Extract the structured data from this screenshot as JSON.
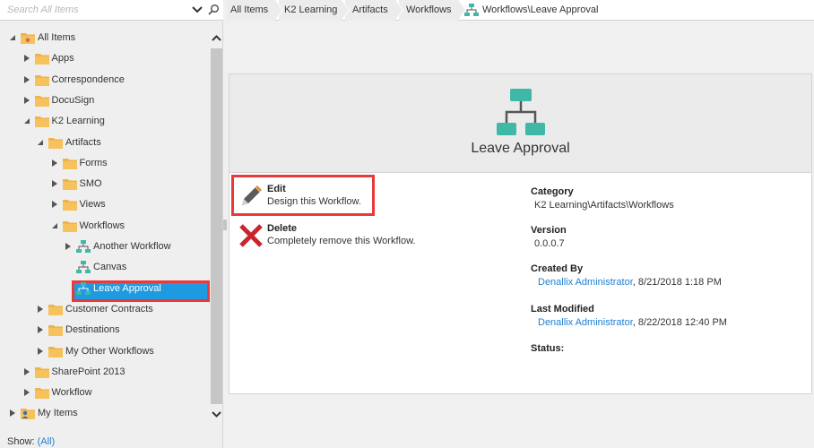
{
  "search": {
    "placeholder": "Search All Items"
  },
  "tree": {
    "all_items": "All Items",
    "apps": "Apps",
    "correspondence": "Correspondence",
    "docusign": "DocuSign",
    "k2_learning": "K2 Learning",
    "artifacts": "Artifacts",
    "forms": "Forms",
    "smo": "SMO",
    "views": "Views",
    "workflows": "Workflows",
    "another_workflow": "Another Workflow",
    "canvas": "Canvas",
    "leave_approval": "Leave Approval",
    "customer_contracts": "Customer Contracts",
    "destinations": "Destinations",
    "my_other_workflows": "My Other Workflows",
    "sharepoint_2013": "SharePoint 2013",
    "workflow": "Workflow",
    "my_items": "My Items"
  },
  "show": {
    "label": "Show:",
    "value": "(All)"
  },
  "breadcrumb": {
    "items": [
      "All Items",
      "K2 Learning",
      "Artifacts",
      "Workflows"
    ],
    "current": "Workflows\\Leave Approval"
  },
  "card": {
    "title": "Leave Approval",
    "edit": {
      "label": "Edit",
      "desc": "Design this Workflow."
    },
    "delete": {
      "label": "Delete",
      "desc": "Completely remove this Workflow."
    },
    "category": {
      "label": "Category",
      "value": "K2 Learning\\Artifacts\\Workflows"
    },
    "version": {
      "label": "Version",
      "value": "0.0.0.7"
    },
    "created_by": {
      "label": "Created By",
      "user": "Denallix Administrator",
      "date": ", 8/21/2018 1:18 PM"
    },
    "last_modified": {
      "label": "Last Modified",
      "user": "Denallix Administrator",
      "date": ", 8/22/2018 12:40 PM"
    },
    "status": {
      "label": "Status:"
    }
  },
  "colors": {
    "selection": "#1e9ae0",
    "highlight": "#e8393b",
    "link": "#1e7fd0",
    "folder": "#f0b24a",
    "workflow_icon": "#3fb8a8"
  }
}
